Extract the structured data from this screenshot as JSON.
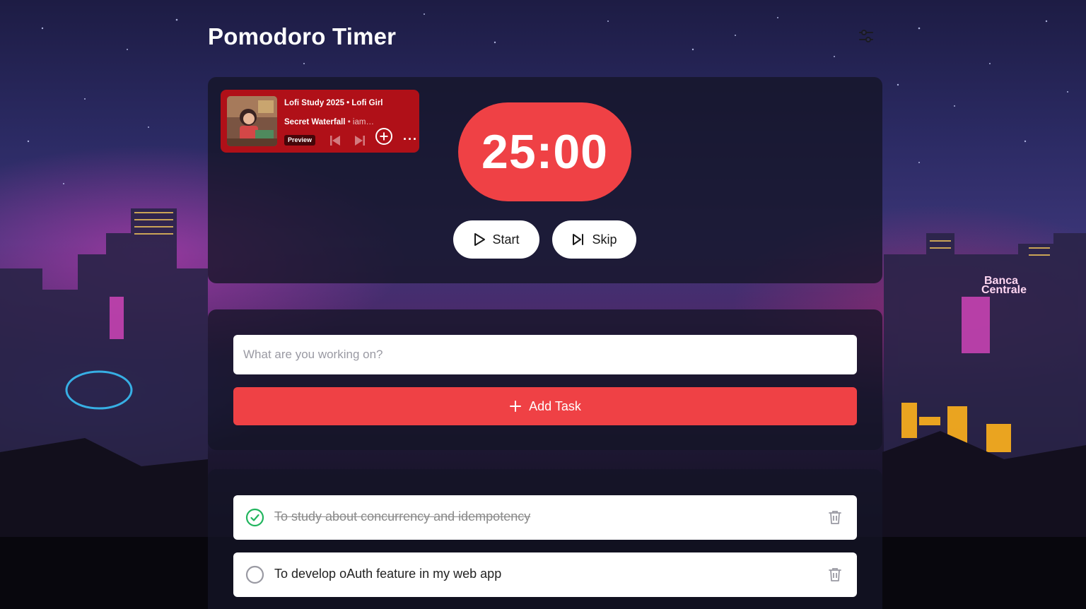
{
  "app": {
    "title": "Pomodoro Timer",
    "settings_icon": "sliders-icon"
  },
  "player": {
    "playlist": "Lofi Study 2025 • Lofi Girl",
    "track_title": "Secret Waterfall",
    "track_separator": " • ",
    "track_artist": "iam…",
    "badge": "Preview",
    "icons": [
      "skip-back-icon",
      "skip-forward-icon",
      "add-circle-icon",
      "more-icon"
    ],
    "more_label": "···",
    "color": "#b01018"
  },
  "timer": {
    "display": "25:00",
    "start_label": "Start",
    "skip_label": "Skip",
    "accent": "#ef4145"
  },
  "task_form": {
    "placeholder": "What are you working on?",
    "value": "",
    "add_label": "Add Task"
  },
  "tasks": [
    {
      "text": "To study about concurrency and idempotency",
      "completed": true
    },
    {
      "text": "To develop oAuth feature in my web app",
      "completed": false
    }
  ]
}
